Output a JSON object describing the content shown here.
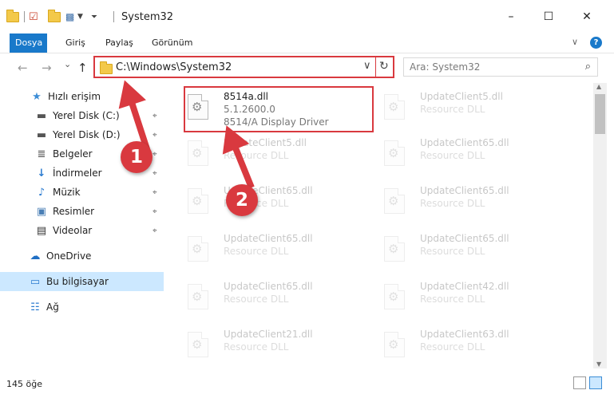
{
  "window": {
    "title": "System32",
    "minimize_icon": "–",
    "maximize_icon": "☐",
    "close_icon": "✕"
  },
  "ribbon": {
    "tabs": [
      {
        "label": "Dosya"
      },
      {
        "label": "Giriş"
      },
      {
        "label": "Paylaş"
      },
      {
        "label": "Görünüm"
      }
    ],
    "expand_icon": "∨",
    "help_icon": "?"
  },
  "nav": {
    "back_icon": "←",
    "forward_icon": "→",
    "recent_icon": "⌄",
    "up_icon": "↑"
  },
  "address": {
    "path": "C:\\Windows\\System32",
    "dropdown_icon": "∨",
    "refresh_icon": "↻"
  },
  "search": {
    "placeholder": "Ara: System32",
    "icon": "⌕"
  },
  "sidebar": {
    "items": [
      {
        "label": "Hızlı erişim",
        "icon": "★",
        "pinned": false
      },
      {
        "label": "Yerel Disk (C:)",
        "icon": "▬",
        "pinned": true
      },
      {
        "label": "Yerel Disk (D:)",
        "icon": "▬",
        "pinned": true
      },
      {
        "label": "Belgeler",
        "icon": "≣",
        "pinned": true
      },
      {
        "label": "İndirmeler",
        "icon": "↓",
        "pinned": true
      },
      {
        "label": "Müzik",
        "icon": "♪",
        "pinned": true
      },
      {
        "label": "Resimler",
        "icon": "▣",
        "pinned": true
      },
      {
        "label": "Videolar",
        "icon": "▤",
        "pinned": true
      },
      {
        "label": "OneDrive",
        "icon": "☁",
        "pinned": false
      },
      {
        "label": "Bu bilgisayar",
        "icon": "▭",
        "pinned": false
      },
      {
        "label": "Ağ",
        "icon": "☷",
        "pinned": false
      }
    ],
    "pin_icon": "⌖"
  },
  "files": {
    "highlighted": {
      "name": "8514a.dll",
      "version": "5.1.2600.0",
      "description": "8514/A Display Driver"
    },
    "left_column": [
      {
        "name": "UpdateClient5.dll",
        "type": "Resource DLL"
      },
      {
        "name": "UpdateClient65.dll",
        "type": "Resource DLL"
      },
      {
        "name": "UpdateClient65.dll",
        "type": "Resource DLL"
      },
      {
        "name": "UpdateClient65.dll",
        "type": "Resource DLL"
      },
      {
        "name": "UpdateClient21.dll",
        "type": "Resource DLL"
      }
    ],
    "right_column": [
      {
        "name": "UpdateClient5.dll",
        "type": "Resource DLL"
      },
      {
        "name": "UpdateClient65.dll",
        "type": "Resource DLL"
      },
      {
        "name": "UpdateClient65.dll",
        "type": "Resource DLL"
      },
      {
        "name": "UpdateClient65.dll",
        "type": "Resource DLL"
      },
      {
        "name": "UpdateClient42.dll",
        "type": "Resource DLL"
      },
      {
        "name": "UpdateClient63.dll",
        "type": "Resource DLL"
      }
    ]
  },
  "status": {
    "item_count": "145 öğe"
  },
  "callouts": [
    {
      "number": "1"
    },
    {
      "number": "2"
    }
  ],
  "colors": {
    "accent": "#1979ca",
    "highlight_red": "#d9393f",
    "selection": "#cce8ff"
  }
}
